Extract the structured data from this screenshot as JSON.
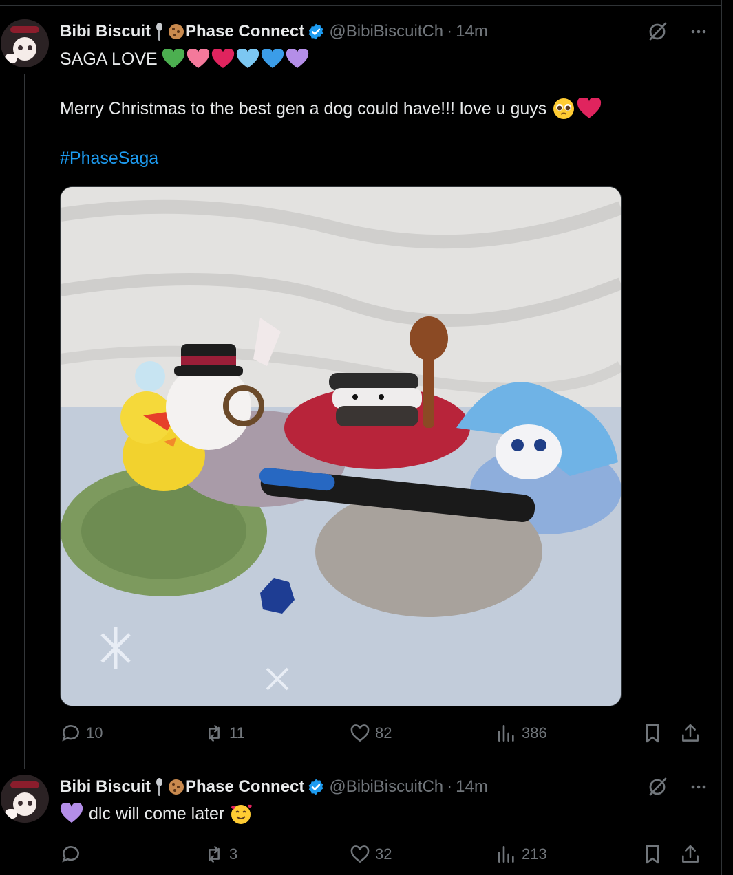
{
  "tweets": [
    {
      "display_name": "Bibi Biscuit",
      "affiliation": "Phase Connect",
      "handle": "@BibiBiscuitCh",
      "separator": "·",
      "time": "14m",
      "text_line1": "SAGA LOVE",
      "heart_colors": [
        "#4caf50",
        "#f4799b",
        "#e0245e",
        "#7cc7f2",
        "#3b9de8",
        "#b48ee8"
      ],
      "text_line2": "Merry Christmas to the best gen a dog could have!!! love u guys",
      "hashtag": "#PhaseSaga",
      "stats": {
        "replies": "10",
        "reposts": "11",
        "likes": "82",
        "views": "386"
      }
    },
    {
      "display_name": "Bibi Biscuit",
      "affiliation": "Phase Connect",
      "handle": "@BibiBiscuitCh",
      "separator": "·",
      "time": "14m",
      "text_line1": "dlc will come later",
      "stats": {
        "replies": "",
        "reposts": "3",
        "likes": "32",
        "views": "213"
      }
    }
  ],
  "icons": {
    "spoon": "spoon-icon",
    "cookie": "cookie-icon",
    "verified": "verified-badge-icon",
    "grok": "grok-icon",
    "more": "more-icon",
    "reply": "reply-icon",
    "repost": "repost-icon",
    "like": "like-icon",
    "views": "views-icon",
    "bookmark": "bookmark-icon",
    "share": "share-icon"
  },
  "colors": {
    "link": "#1d9bf0",
    "verified": "#1d9bf0",
    "muted": "#71767b",
    "text": "#e7e9ea"
  }
}
